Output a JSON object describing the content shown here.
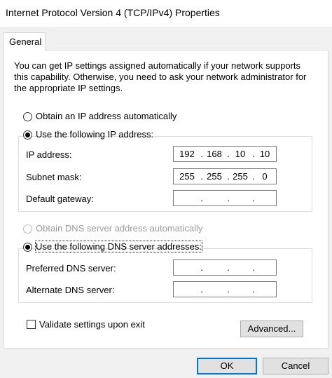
{
  "window": {
    "title": "Internet Protocol Version 4 (TCP/IPv4) Properties"
  },
  "tabs": [
    {
      "label": "General",
      "selected": true
    }
  ],
  "description": "You can get IP settings assigned automatically if your network supports this capability. Otherwise, you need to ask your network administrator for the appropriate IP settings.",
  "ip_mode": {
    "auto_label": "Obtain an IP address automatically",
    "manual_label": "Use the following IP address:",
    "selected": "manual"
  },
  "ip_fields": [
    {
      "label": "IP address:",
      "octets": [
        "192",
        "168",
        "10",
        "10"
      ]
    },
    {
      "label": "Subnet mask:",
      "octets": [
        "255",
        "255",
        "255",
        "0"
      ]
    },
    {
      "label": "Default gateway:",
      "octets": [
        "",
        "",
        "",
        ""
      ]
    }
  ],
  "dns_mode": {
    "auto_label": "Obtain DNS server address automatically",
    "auto_enabled": false,
    "manual_label": "Use the following DNS server addresses:",
    "selected": "manual"
  },
  "dns_fields": [
    {
      "label": "Preferred DNS server:",
      "octets": [
        "",
        "",
        "",
        ""
      ]
    },
    {
      "label": "Alternate DNS server:",
      "octets": [
        "",
        "",
        "",
        ""
      ]
    }
  ],
  "validate": {
    "label": "Validate settings upon exit",
    "checked": false
  },
  "buttons": {
    "advanced": "Advanced...",
    "ok": "OK",
    "cancel": "Cancel"
  },
  "ip_dot": "."
}
